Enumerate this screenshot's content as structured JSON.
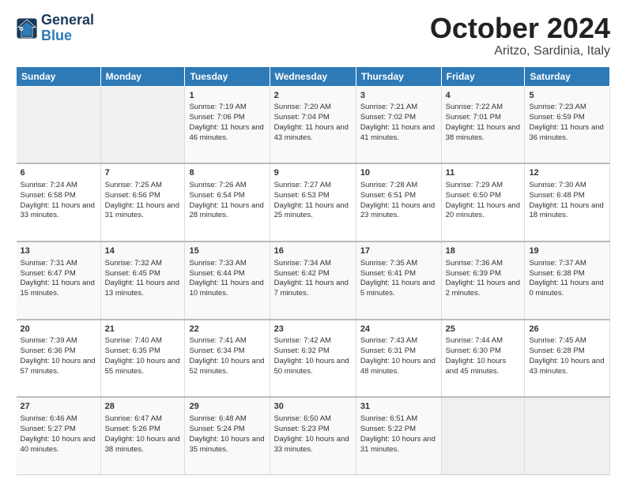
{
  "header": {
    "logo_line1": "General",
    "logo_line2": "Blue",
    "title": "October 2024",
    "subtitle": "Aritzo, Sardinia, Italy"
  },
  "columns": [
    "Sunday",
    "Monday",
    "Tuesday",
    "Wednesday",
    "Thursday",
    "Friday",
    "Saturday"
  ],
  "weeks": [
    {
      "days": [
        {
          "num": "",
          "content": ""
        },
        {
          "num": "",
          "content": ""
        },
        {
          "num": "1",
          "content": "Sunrise: 7:19 AM\nSunset: 7:06 PM\nDaylight: 11 hours and 46 minutes."
        },
        {
          "num": "2",
          "content": "Sunrise: 7:20 AM\nSunset: 7:04 PM\nDaylight: 11 hours and 43 minutes."
        },
        {
          "num": "3",
          "content": "Sunrise: 7:21 AM\nSunset: 7:02 PM\nDaylight: 11 hours and 41 minutes."
        },
        {
          "num": "4",
          "content": "Sunrise: 7:22 AM\nSunset: 7:01 PM\nDaylight: 11 hours and 38 minutes."
        },
        {
          "num": "5",
          "content": "Sunrise: 7:23 AM\nSunset: 6:59 PM\nDaylight: 11 hours and 36 minutes."
        }
      ]
    },
    {
      "days": [
        {
          "num": "6",
          "content": "Sunrise: 7:24 AM\nSunset: 6:58 PM\nDaylight: 11 hours and 33 minutes."
        },
        {
          "num": "7",
          "content": "Sunrise: 7:25 AM\nSunset: 6:56 PM\nDaylight: 11 hours and 31 minutes."
        },
        {
          "num": "8",
          "content": "Sunrise: 7:26 AM\nSunset: 6:54 PM\nDaylight: 11 hours and 28 minutes."
        },
        {
          "num": "9",
          "content": "Sunrise: 7:27 AM\nSunset: 6:53 PM\nDaylight: 11 hours and 25 minutes."
        },
        {
          "num": "10",
          "content": "Sunrise: 7:28 AM\nSunset: 6:51 PM\nDaylight: 11 hours and 23 minutes."
        },
        {
          "num": "11",
          "content": "Sunrise: 7:29 AM\nSunset: 6:50 PM\nDaylight: 11 hours and 20 minutes."
        },
        {
          "num": "12",
          "content": "Sunrise: 7:30 AM\nSunset: 6:48 PM\nDaylight: 11 hours and 18 minutes."
        }
      ]
    },
    {
      "days": [
        {
          "num": "13",
          "content": "Sunrise: 7:31 AM\nSunset: 6:47 PM\nDaylight: 11 hours and 15 minutes."
        },
        {
          "num": "14",
          "content": "Sunrise: 7:32 AM\nSunset: 6:45 PM\nDaylight: 11 hours and 13 minutes."
        },
        {
          "num": "15",
          "content": "Sunrise: 7:33 AM\nSunset: 6:44 PM\nDaylight: 11 hours and 10 minutes."
        },
        {
          "num": "16",
          "content": "Sunrise: 7:34 AM\nSunset: 6:42 PM\nDaylight: 11 hours and 7 minutes."
        },
        {
          "num": "17",
          "content": "Sunrise: 7:35 AM\nSunset: 6:41 PM\nDaylight: 11 hours and 5 minutes."
        },
        {
          "num": "18",
          "content": "Sunrise: 7:36 AM\nSunset: 6:39 PM\nDaylight: 11 hours and 2 minutes."
        },
        {
          "num": "19",
          "content": "Sunrise: 7:37 AM\nSunset: 6:38 PM\nDaylight: 11 hours and 0 minutes."
        }
      ]
    },
    {
      "days": [
        {
          "num": "20",
          "content": "Sunrise: 7:39 AM\nSunset: 6:36 PM\nDaylight: 10 hours and 57 minutes."
        },
        {
          "num": "21",
          "content": "Sunrise: 7:40 AM\nSunset: 6:35 PM\nDaylight: 10 hours and 55 minutes."
        },
        {
          "num": "22",
          "content": "Sunrise: 7:41 AM\nSunset: 6:34 PM\nDaylight: 10 hours and 52 minutes."
        },
        {
          "num": "23",
          "content": "Sunrise: 7:42 AM\nSunset: 6:32 PM\nDaylight: 10 hours and 50 minutes."
        },
        {
          "num": "24",
          "content": "Sunrise: 7:43 AM\nSunset: 6:31 PM\nDaylight: 10 hours and 48 minutes."
        },
        {
          "num": "25",
          "content": "Sunrise: 7:44 AM\nSunset: 6:30 PM\nDaylight: 10 hours and 45 minutes."
        },
        {
          "num": "26",
          "content": "Sunrise: 7:45 AM\nSunset: 6:28 PM\nDaylight: 10 hours and 43 minutes."
        }
      ]
    },
    {
      "days": [
        {
          "num": "27",
          "content": "Sunrise: 6:46 AM\nSunset: 5:27 PM\nDaylight: 10 hours and 40 minutes."
        },
        {
          "num": "28",
          "content": "Sunrise: 6:47 AM\nSunset: 5:26 PM\nDaylight: 10 hours and 38 minutes."
        },
        {
          "num": "29",
          "content": "Sunrise: 6:48 AM\nSunset: 5:24 PM\nDaylight: 10 hours and 35 minutes."
        },
        {
          "num": "30",
          "content": "Sunrise: 6:50 AM\nSunset: 5:23 PM\nDaylight: 10 hours and 33 minutes."
        },
        {
          "num": "31",
          "content": "Sunrise: 6:51 AM\nSunset: 5:22 PM\nDaylight: 10 hours and 31 minutes."
        },
        {
          "num": "",
          "content": ""
        },
        {
          "num": "",
          "content": ""
        }
      ]
    }
  ]
}
